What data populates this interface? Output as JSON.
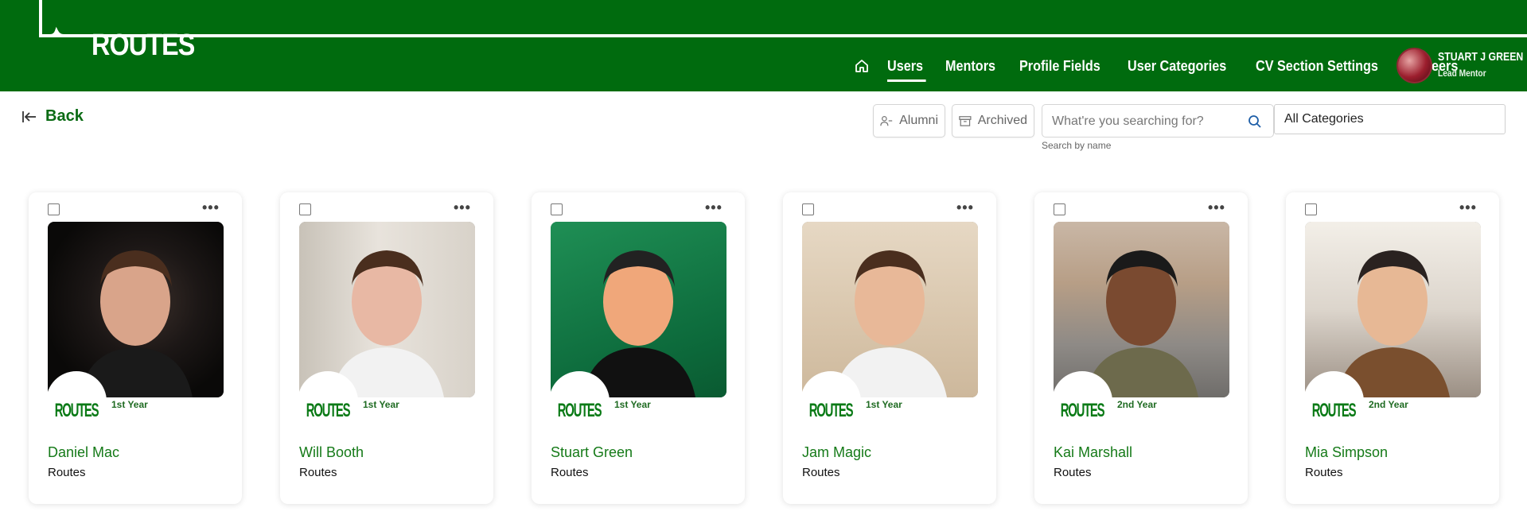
{
  "header": {
    "logo_text": "ROUTES",
    "nav": {
      "home_icon": "home-icon",
      "items": [
        {
          "label": "Users",
          "active": true
        },
        {
          "label": "Mentors",
          "active": false
        },
        {
          "label": "Profile Fields",
          "active": false
        },
        {
          "label": "User Categories",
          "active": false
        },
        {
          "label": "CV Section Settings",
          "active": false
        },
        {
          "label": "Careers",
          "active": false
        }
      ]
    },
    "user": {
      "name": "STUART J GREEN",
      "role": "Lead Mentor"
    }
  },
  "toolbar": {
    "back_label": "Back",
    "alumni_label": "Alumni",
    "archived_label": "Archived",
    "search_placeholder": "What're you searching for?",
    "search_value": "",
    "search_hint": "Search by name",
    "category_selected": "All Categories"
  },
  "cards": [
    {
      "name": "Daniel Mac",
      "org": "Routes",
      "year": "1st Year",
      "badge": "ROUTES",
      "photo_theme": "dark"
    },
    {
      "name": "Will Booth",
      "org": "Routes",
      "year": "1st Year",
      "badge": "ROUTES",
      "photo_theme": "light"
    },
    {
      "name": "Stuart Green",
      "org": "Routes",
      "year": "1st Year",
      "badge": "ROUTES",
      "photo_theme": "green"
    },
    {
      "name": "Jam Magic",
      "org": "Routes",
      "year": "1st Year",
      "badge": "ROUTES",
      "photo_theme": "beige"
    },
    {
      "name": "Kai Marshall",
      "org": "Routes",
      "year": "2nd Year",
      "badge": "ROUTES",
      "photo_theme": "street"
    },
    {
      "name": "Mia Simpson",
      "org": "Routes",
      "year": "2nd Year",
      "badge": "ROUTES",
      "photo_theme": "outdoor"
    }
  ],
  "colors": {
    "brand_green": "#006b0e",
    "name_green": "#157a18"
  }
}
